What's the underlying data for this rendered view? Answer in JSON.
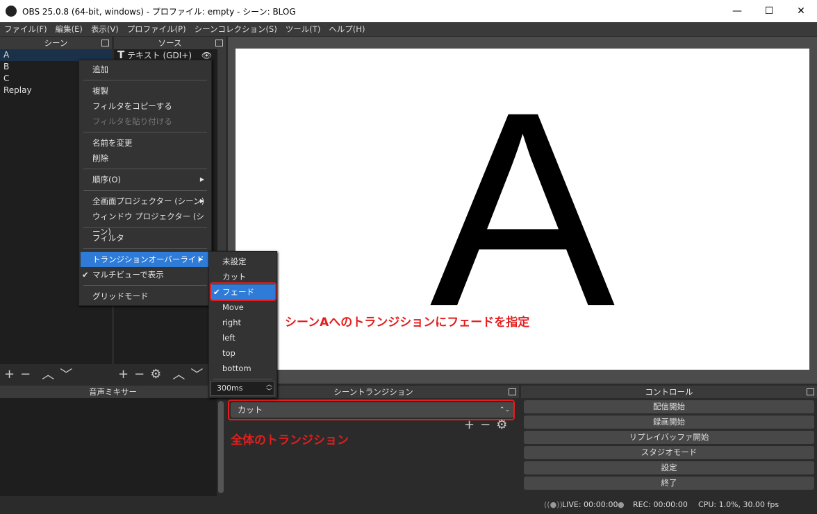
{
  "window": {
    "title": "OBS 25.0.8 (64-bit, windows) - プロファイル: empty - シーン: BLOG",
    "minimize": "—",
    "maximize": "☐",
    "close": "✕"
  },
  "menu": [
    "ファイル(F)",
    "編集(E)",
    "表示(V)",
    "プロファイル(P)",
    "シーンコレクション(S)",
    "ツール(T)",
    "ヘルプ(H)"
  ],
  "scenes": {
    "title": "シーン",
    "items": [
      "A",
      "B",
      "C",
      "Replay"
    ],
    "selected": "A"
  },
  "sources": {
    "title": "ソース",
    "items": [
      {
        "name": "テキスト (GDI+)",
        "visible": true,
        "locked": false
      }
    ]
  },
  "context_menu": {
    "items": [
      "追加",
      "複製",
      "フィルタをコピーする",
      "フィルタを貼り付ける",
      "名前を変更",
      "削除",
      "順序(O)",
      "全画面プロジェクター (シーン)",
      "ウィンドウ プロジェクター (シーン)",
      "フィルタ",
      "トランジションオーバーライド",
      "マルチビューで表示",
      "グリッドモード"
    ],
    "disabled": [
      "フィルタを貼り付ける"
    ],
    "highlighted": "トランジションオーバーライド",
    "checked": [
      "マルチビューで表示"
    ]
  },
  "submenu": {
    "items": [
      "未設定",
      "カット",
      "フェード",
      "Move",
      "right",
      "left",
      "top",
      "bottom"
    ],
    "checked": "フェード",
    "duration": "300ms"
  },
  "preview": {
    "text": "A"
  },
  "mixer": {
    "title": "音声ミキサー"
  },
  "transition": {
    "title": "シーントランジション",
    "selected": "カット"
  },
  "controls": {
    "title": "コントロール",
    "buttons": [
      "配信開始",
      "録画開始",
      "リプレイバッファ開始",
      "スタジオモード",
      "設定",
      "終了"
    ]
  },
  "status": {
    "live": "LIVE: 00:00:00",
    "rec": "REC: 00:00:00",
    "cpu": "CPU: 1.0%, 30.00 fps"
  },
  "annotations": {
    "scene_override": "シーンAへのトランジションにフェードを指定",
    "global": "全体のトランジション"
  },
  "colors": {
    "accent": "#2f7bd8",
    "annotation": "#e51d1d"
  }
}
